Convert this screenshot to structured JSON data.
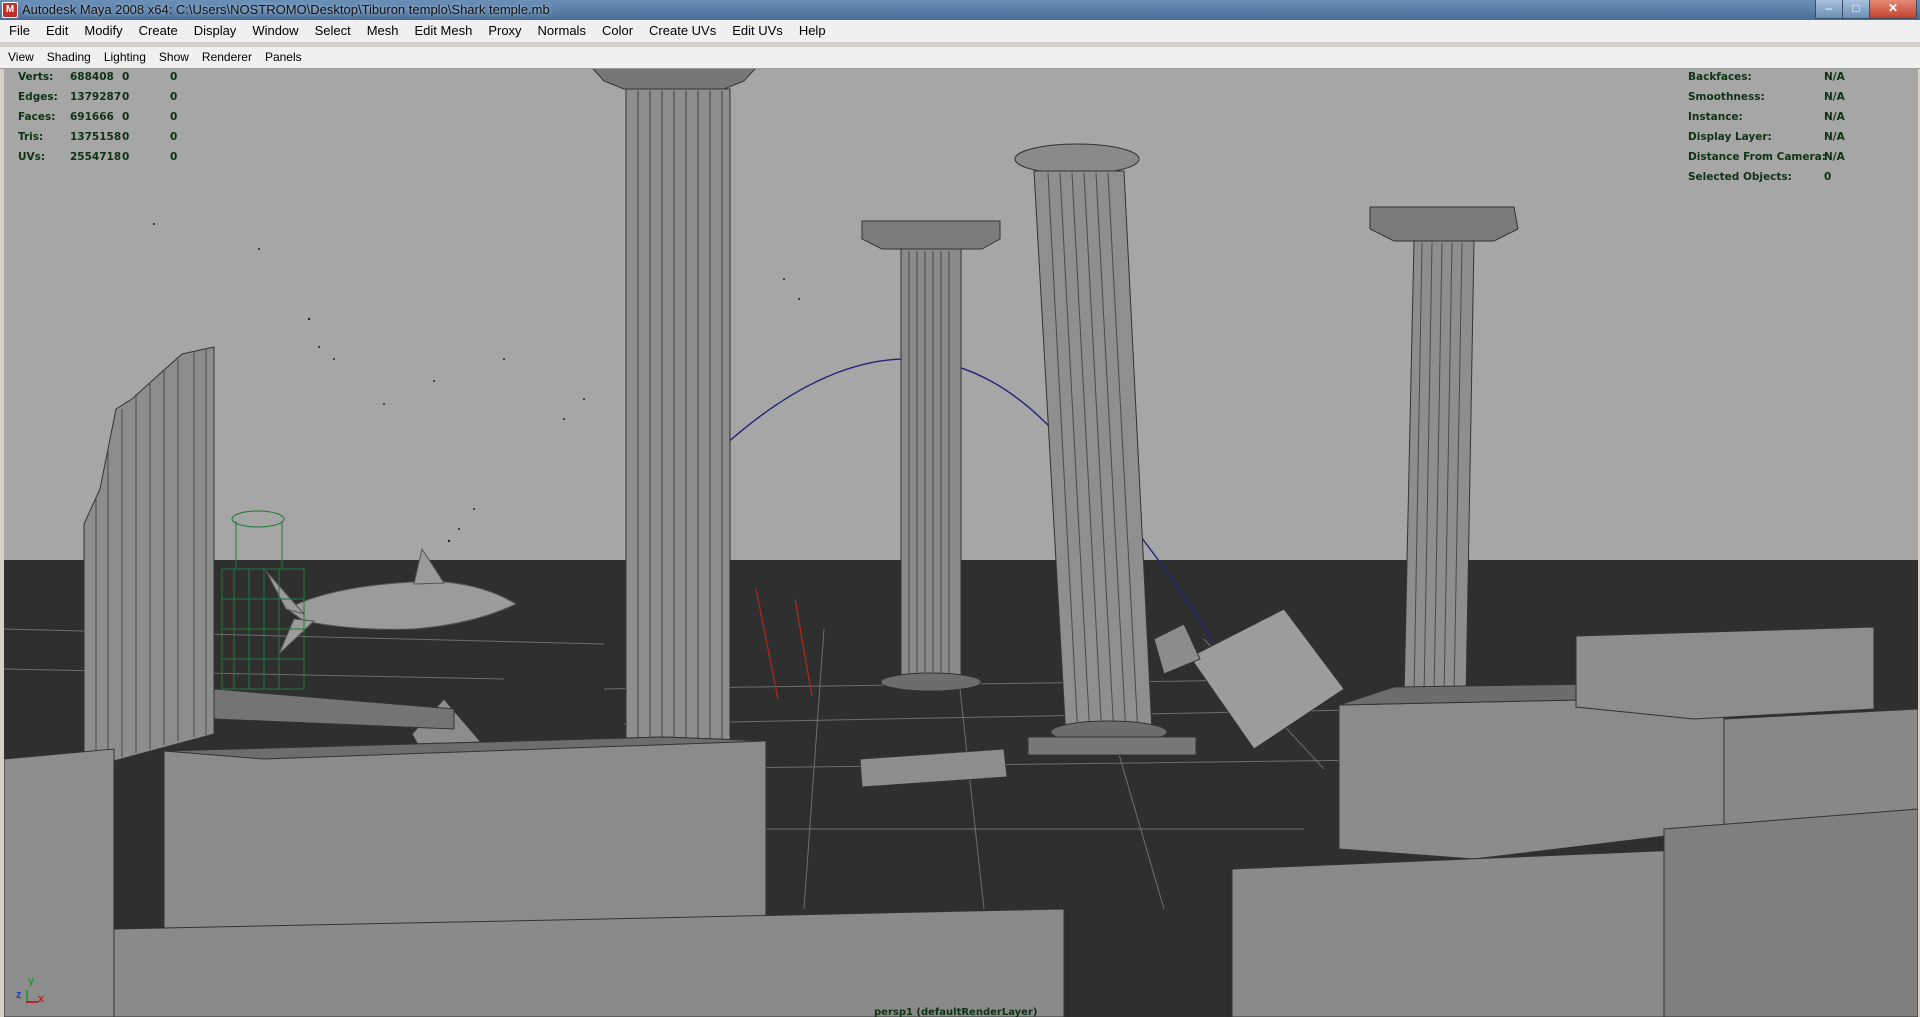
{
  "window": {
    "title": "Autodesk Maya 2008 x64: C:\\Users\\NOSTROMO\\Desktop\\Tiburon templo\\Shark temple.mb",
    "min_glyph": "–",
    "max_glyph": "□",
    "close_glyph": "✕"
  },
  "menubar": [
    "File",
    "Edit",
    "Modify",
    "Create",
    "Display",
    "Window",
    "Select",
    "Mesh",
    "Edit Mesh",
    "Proxy",
    "Normals",
    "Color",
    "Create UVs",
    "Edit UVs",
    "Help"
  ],
  "panel_menu": [
    "View",
    "Shading",
    "Lighting",
    "Show",
    "Renderer",
    "Panels"
  ],
  "hud_left": [
    {
      "label": "Verts:",
      "total": "688408",
      "sel": "0",
      "comp": "0"
    },
    {
      "label": "Edges:",
      "total": "1379287",
      "sel": "0",
      "comp": "0"
    },
    {
      "label": "Faces:",
      "total": "691666",
      "sel": "0",
      "comp": "0"
    },
    {
      "label": "Tris:",
      "total": "1375158",
      "sel": "0",
      "comp": "0"
    },
    {
      "label": "UVs:",
      "total": "2554718",
      "sel": "0",
      "comp": "0"
    }
  ],
  "hud_right": [
    {
      "label": "Backfaces:",
      "value": "N/A"
    },
    {
      "label": "Smoothness:",
      "value": "N/A"
    },
    {
      "label": "Instance:",
      "value": "N/A"
    },
    {
      "label": "Display Layer:",
      "value": "N/A"
    },
    {
      "label": "Distance From Camera:",
      "value": "N/A"
    },
    {
      "label": "Selected Objects:",
      "value": "0"
    }
  ],
  "axis": {
    "y": "y",
    "z": "z",
    "x": "x"
  },
  "camera_label": "persp1 (defaultRenderLayer)",
  "colors": {
    "viewport_bg": "#a6a6a6",
    "ground": "#2f2f2f",
    "hud_text": "#0d3312",
    "title_grad_top": "#6b90b8"
  }
}
